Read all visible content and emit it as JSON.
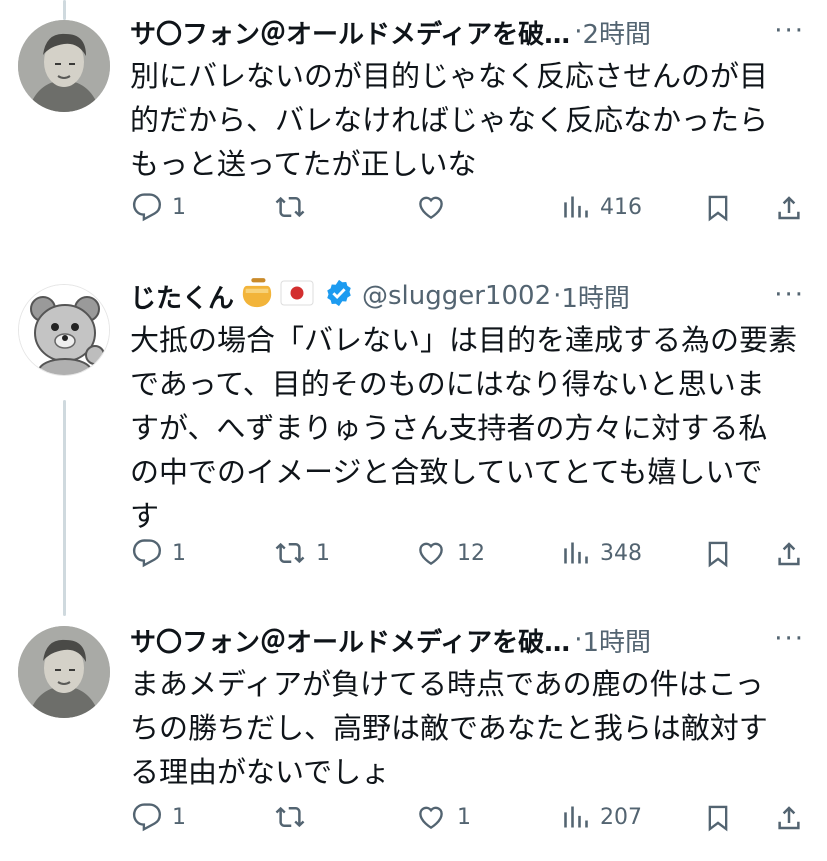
{
  "tweets": [
    {
      "name": "サ〇フォン＠オールドメディアを破…",
      "handle": "",
      "dot": "·",
      "time": "2時間",
      "body": "別にバレないのが目的じゃなく反応させんのが目\n的だから、バレなければじゃなく反応なかったら\nもっと送ってたが正しいな",
      "reply_count": "1",
      "retweet_count": "",
      "like_count": "",
      "view_count": "416"
    },
    {
      "name": "じたくん",
      "handle": "@slugger1002",
      "dot": "·",
      "time": "1時間",
      "body": "大抵の場合「バレない」は目的を達成する為の要素\nであって、目的そのものにはなり得ないと思いま\nすが、へずまりゅうさん支持者の方々に対する私\nの中でのイメージと合致していてとても嬉しいで\nす",
      "reply_count": "1",
      "retweet_count": "1",
      "like_count": "12",
      "view_count": "348"
    },
    {
      "name": "サ〇フォン＠オールドメディアを破…",
      "handle": "",
      "dot": "·",
      "time": "1時間",
      "body": "まあメディアが負けてる時点であの鹿の件はこっ\nちの勝ちだし、高野は敵であなたと我らは敵対す\nる理由がないでしょ",
      "reply_count": "1",
      "retweet_count": "",
      "like_count": "1",
      "view_count": "207"
    }
  ],
  "more_label": "···",
  "icons": {
    "honey": "honey-pot-icon",
    "flag": "japan-flag-icon",
    "verified": "verified-badge-icon",
    "reply": "reply-icon",
    "retweet": "retweet-icon",
    "like": "like-icon",
    "views": "views-icon",
    "bookmark": "bookmark-icon",
    "share": "share-icon"
  },
  "colors": {
    "text": "#0f1419",
    "muted": "#536471",
    "verified": "#1d9bf0",
    "thread_line": "#cfd9de"
  }
}
